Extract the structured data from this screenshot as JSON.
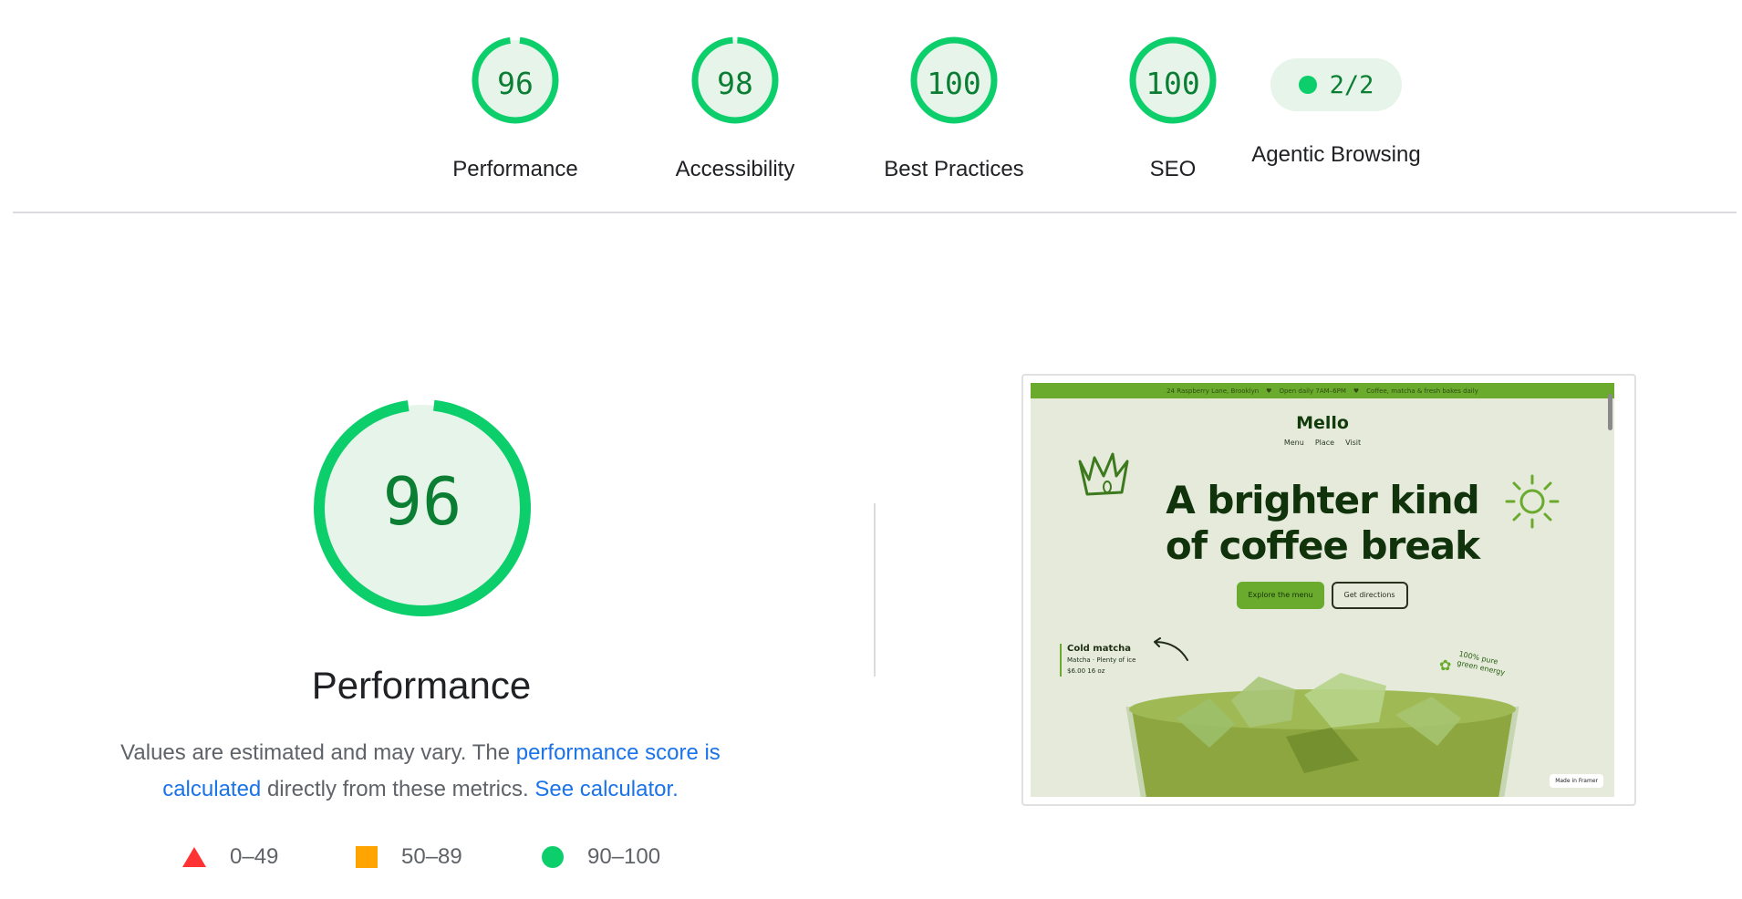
{
  "categories": [
    {
      "score": "96",
      "label": "Performance",
      "value": 96
    },
    {
      "score": "98",
      "label": "Accessibility",
      "value": 98
    },
    {
      "score": "100",
      "label": "Best Practices",
      "value": 100
    },
    {
      "score": "100",
      "label": "SEO",
      "value": 100
    }
  ],
  "agentic": {
    "score": "2/2",
    "label": "Agentic Browsing"
  },
  "performance": {
    "score": "96",
    "value": 96,
    "title": "Performance",
    "desc_prefix": "Values are estimated and may vary. The ",
    "link1": "performance score is calculated",
    "desc_mid": " directly from these metrics. ",
    "link2": "See calculator."
  },
  "legend": {
    "fail": "0–49",
    "average": "50–89",
    "pass": "90–100"
  },
  "screenshot": {
    "topbar": [
      "24 Raspberry Lane, Brooklyn",
      "♥",
      "Open daily 7AM–6PM",
      "♥",
      "Coffee, matcha & fresh bakes daily"
    ],
    "logo": "Mello",
    "nav": [
      "Menu",
      "Place",
      "Visit"
    ],
    "headline_1": "A brighter kind",
    "headline_2": "of coffee break",
    "cta_primary": "Explore the menu",
    "cta_secondary": "Get directions",
    "card_title": "Cold matcha",
    "card_sub": "Matcha · Plenty of ice",
    "card_price": "$6.00",
    "card_size": "16 oz",
    "pure_1": "100% pure",
    "pure_2": "green energy",
    "framer_badge": "Made in Framer"
  },
  "colors": {
    "pass": "#0cce6b",
    "pass_text": "#0b7e34",
    "pass_bg": "#e6f4ea",
    "average": "#ffa400",
    "fail": "#ff3333",
    "link": "#1a73e8"
  }
}
